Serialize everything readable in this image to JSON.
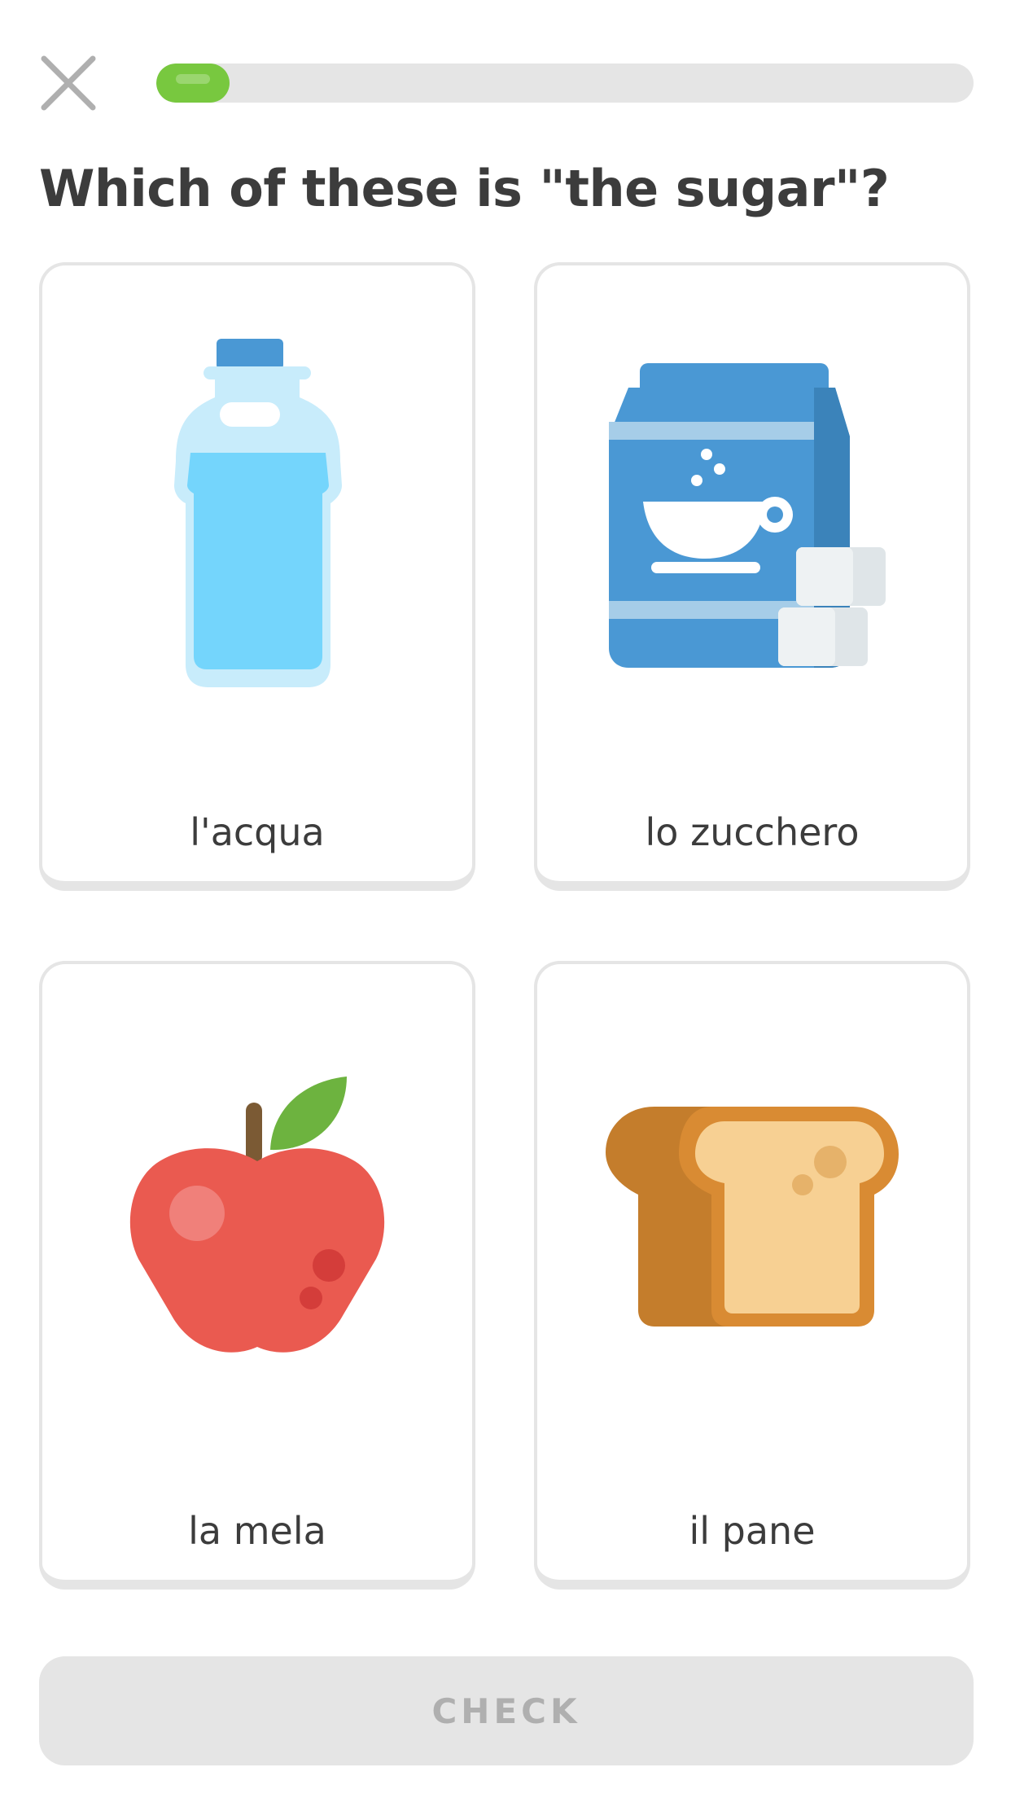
{
  "header": {
    "close_icon": "close-icon",
    "progress": 0.09,
    "progress_color": "#78c83f"
  },
  "prompt": "Which of these is \"the sugar\"?",
  "options": [
    {
      "label": "l'acqua",
      "icon": "water-bottle-icon"
    },
    {
      "label": "lo zucchero",
      "icon": "sugar-bag-icon"
    },
    {
      "label": "la mela",
      "icon": "apple-icon"
    },
    {
      "label": "il pane",
      "icon": "bread-icon"
    }
  ],
  "check_button": {
    "label": "CHECK",
    "enabled": false
  },
  "colors": {
    "text": "#3c3c3c",
    "border": "#e5e5e5",
    "disabled_text": "#afafaf"
  }
}
